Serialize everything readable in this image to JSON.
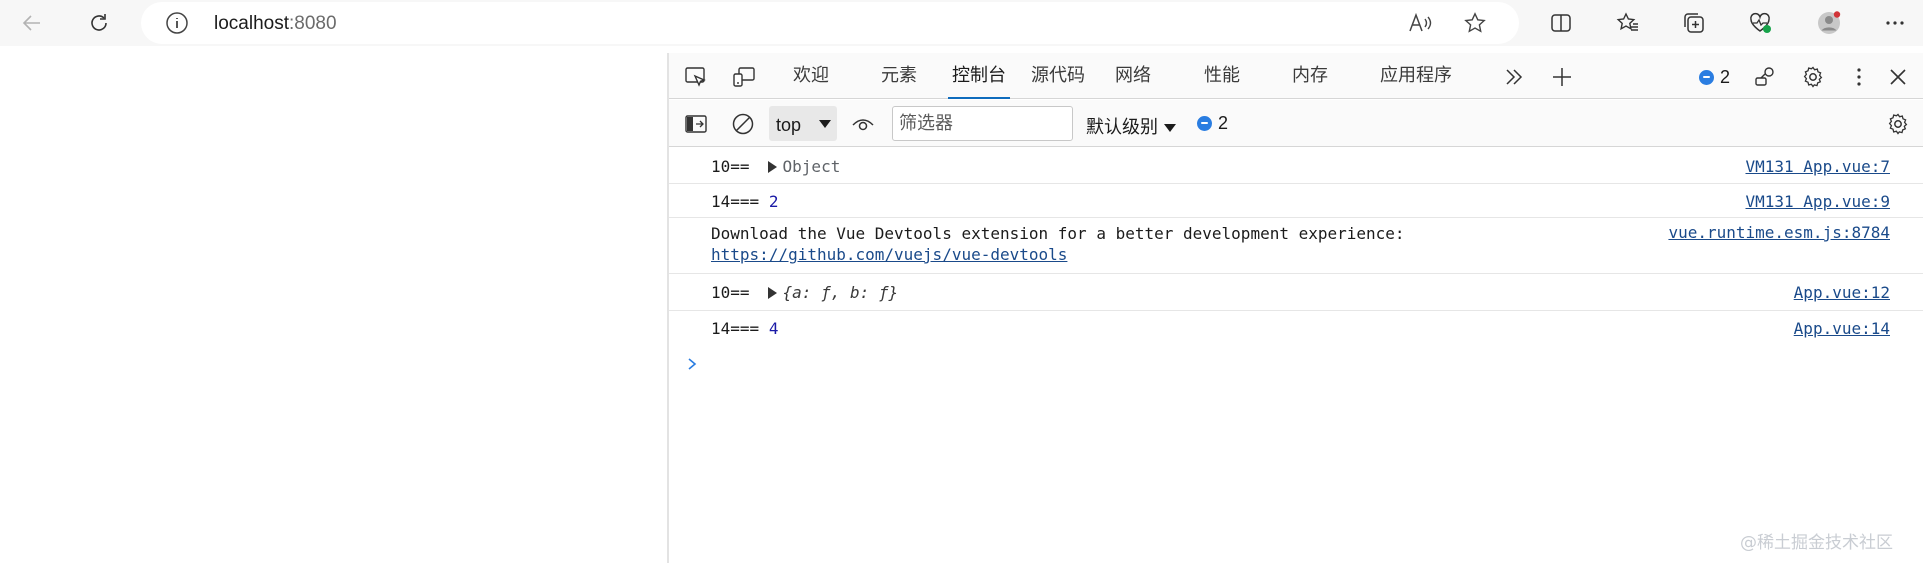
{
  "browser": {
    "address": {
      "host": "localhost",
      "port": ":8080"
    },
    "toolbar_icons": [
      "back-arrow-icon",
      "refresh-icon",
      "site-info-icon",
      "read-aloud-icon",
      "favorite-star-icon",
      "split-screen-icon",
      "favorites-icon",
      "collections-icon",
      "browser-essentials-icon",
      "profile-icon",
      "more-icon"
    ]
  },
  "devtools": {
    "tabs": [
      {
        "label": "欢迎"
      },
      {
        "label": "元素"
      },
      {
        "label": "控制台"
      },
      {
        "label": "源代码"
      },
      {
        "label": "网络"
      },
      {
        "label": "性能"
      },
      {
        "label": "内存"
      },
      {
        "label": "应用程序"
      }
    ],
    "active_tab": "控制台",
    "issues_count": "2",
    "filter_bar": {
      "context": "top",
      "filter_placeholder": "筛选器",
      "levels_label": "默认级别",
      "messages_count": "2"
    },
    "console": {
      "rows": [
        {
          "prefix": "10==",
          "value": "Object",
          "source": "VM131 App.vue:7"
        },
        {
          "prefix": "14===",
          "value": "2",
          "source": "VM131 App.vue:9"
        },
        {
          "line1": "Download the Vue Devtools extension for a better development experience:",
          "link": "https://github.com/vuejs/vue-devtools",
          "source": "vue.runtime.esm.js:8784"
        },
        {
          "prefix": "10==",
          "value": "{a: ƒ, b: ƒ}",
          "source": "App.vue:12"
        },
        {
          "prefix": "14===",
          "value": "4",
          "source": "App.vue:14"
        }
      ]
    }
  },
  "colors": {
    "accent": "#0f6cbd",
    "link": "#1a4a8a",
    "number": "#1a1aa6"
  },
  "watermark": "@稀土掘金技术社区"
}
